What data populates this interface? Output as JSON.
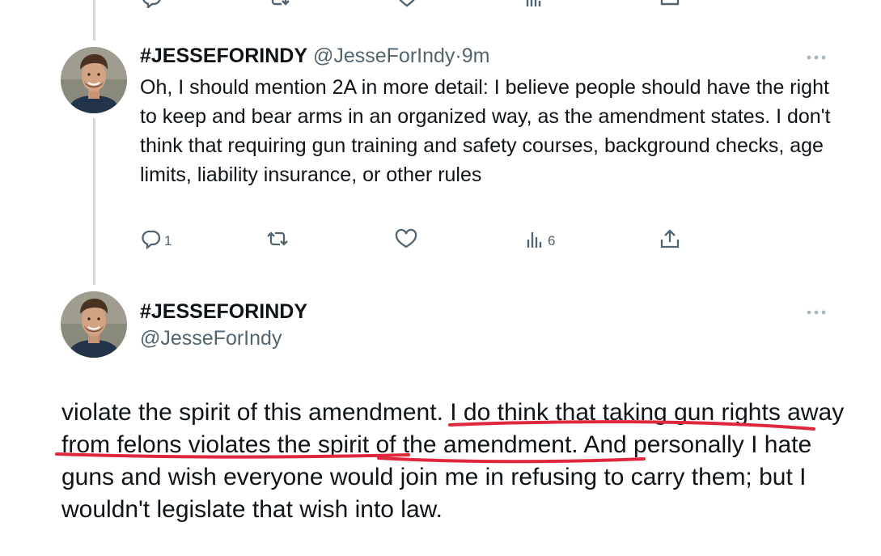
{
  "icons": {
    "reply": "reply-icon",
    "repost": "repost-icon",
    "like": "like-icon",
    "views": "views-icon",
    "share": "share-icon",
    "more": "more-icon"
  },
  "colors": {
    "text": "#0f1419",
    "secondary": "#536471",
    "thread_line": "#cfd9de",
    "annotation": "#e0283c"
  },
  "tweet1": {
    "display_name": "#JESSEFORINDY",
    "handle": "@JesseForIndy",
    "separator": "·",
    "time": "9m",
    "text": "Oh, I should mention 2A in more detail: I believe people should have the right to keep and bear arms in an organized way, as the amendment states. I don't think that requiring gun training and safety courses, background checks, age limits, liability insurance, or other rules",
    "reply_count": "1",
    "views_count": "6"
  },
  "tweet2": {
    "display_name": "#JESSEFORINDY",
    "handle": "@JesseForIndy",
    "text": "violate the spirit of this amendment. I do think that taking gun rights away from felons violates the spirit of the amendment. And personally I hate guns and wish everyone would join me in refusing to carry them; but I wouldn't legislate that wish into law."
  }
}
